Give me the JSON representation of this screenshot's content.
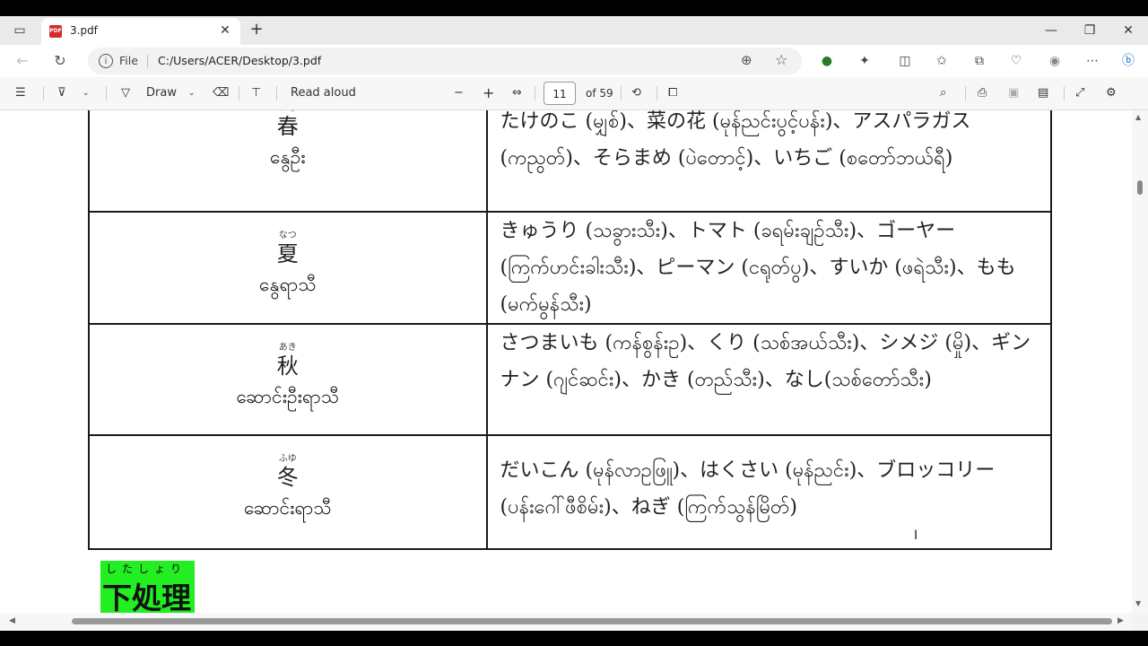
{
  "tab": {
    "title": "3.pdf",
    "pdf_badge": "PDF"
  },
  "address": {
    "scheme_label": "File",
    "url": "C:/Users/ACER/Desktop/3.pdf"
  },
  "toolbar": {
    "draw_label": "Draw",
    "read_aloud_label": "Read aloud",
    "page_current": "11",
    "page_total": "of 59"
  },
  "table": {
    "rows": [
      {
        "ruby": "はる",
        "kanji": "春",
        "season": "နွေဦး",
        "items": "たけのこ (မျှစ်)、菜の花 (မုန်ညင်းပွင့်ပန်း)、アスパラガス(ကညွတ်)、そらまめ (ပဲတောင့်)、いちご (စတော်ဘယ်ရီ)"
      },
      {
        "ruby": "なつ",
        "kanji": "夏",
        "season": "နွေရာသီ",
        "items": "きゅうり (သခွားသီး)、トマト (ခရမ်းချဉ်သီး)、ゴーヤー (ကြက်ဟင်းခါးသီး)、ピーマン (ငရုတ်ပွ)、すいか (ဖရဲသီး)、もも (မက်မွန်သီး)"
      },
      {
        "ruby": "あき",
        "kanji": "秋",
        "season": "ဆောင်းဦးရာသီ",
        "items": "さつまいも (ကန်စွန်းဥ)、くり (သစ်အယ်သီး)、シメジ (မှို)、ギンナン (ဂျင်ဆင်း)、かき (တည်သီး)、なし(သစ်တော်သီး)"
      },
      {
        "ruby": "ふゆ",
        "kanji": "冬",
        "season": "ဆောင်းရာသီ",
        "items": "だいこん (မုန်လာဥဖြူ)、はくさい (မုန်ညင်း)、ブロッコリー (ပန်းဂေါ်ဖီစိမ်း)、ねぎ (ကြက်သွန်မြိတ်)"
      }
    ]
  },
  "heading": {
    "ruby": "したしょり",
    "kanji": "下処理"
  },
  "colors": {
    "heading_bg": "#22ee22"
  }
}
